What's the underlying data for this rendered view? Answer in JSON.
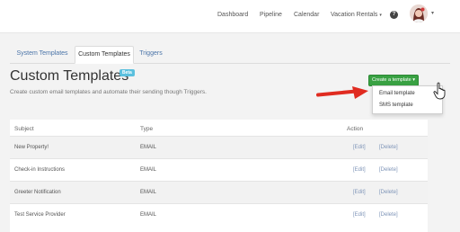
{
  "topbar": {
    "nav": [
      "Dashboard",
      "Pipeline",
      "Calendar",
      "Vacation Rentals"
    ],
    "help_glyph": "?"
  },
  "tabs": [
    "System Templates",
    "Custom Templates",
    "Triggers"
  ],
  "page": {
    "title": "Custom Templates",
    "badge": "Beta",
    "subtitle": "Create custom email templates and automate their sending though Triggers."
  },
  "create": {
    "label": "Create a template",
    "menu": [
      "Email template",
      "SMS template"
    ]
  },
  "table": {
    "headers": [
      "Subject",
      "Type",
      "Action"
    ],
    "rows": [
      {
        "subject": "New Property!",
        "type": "EMAIL",
        "edit": "[Edit]",
        "delete": "[Delete]"
      },
      {
        "subject": "Check-in Instructions",
        "type": "EMAIL",
        "edit": "[Edit]",
        "delete": "[Delete]"
      },
      {
        "subject": "Greeter Notification",
        "type": "EMAIL",
        "edit": "[Edit]",
        "delete": "[Delete]"
      },
      {
        "subject": "Test Service Provider",
        "type": "EMAIL",
        "edit": "[Edit]",
        "delete": "[Delete]"
      }
    ]
  },
  "colors": {
    "primary_button": "#39a143",
    "badge": "#5bc0de",
    "arrow": "#e02b20"
  },
  "icons": [
    "help-icon",
    "user-avatar",
    "dropdown-caret-icon",
    "red-arrow",
    "hand-pointer-icon"
  ]
}
